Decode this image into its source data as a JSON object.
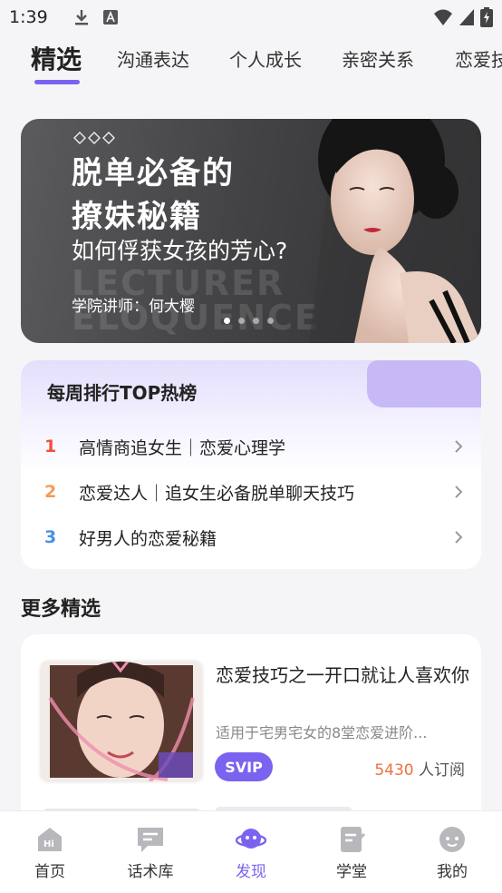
{
  "status_bar": {
    "time": "1:39"
  },
  "tabs": [
    {
      "label": "精选",
      "active": true
    },
    {
      "label": "沟通表达",
      "active": false
    },
    {
      "label": "个人成长",
      "active": false
    },
    {
      "label": "亲密关系",
      "active": false
    },
    {
      "label": "恋爱技",
      "active": false
    }
  ],
  "banner": {
    "title_line1": "脱单必备的",
    "title_line2": "撩妹秘籍",
    "subtitle": "如何俘获女孩的芳心?",
    "watermark_line1": "LECTURER",
    "watermark_line2": "ELOQUENCE",
    "lecturer": "学院讲师：何大樱",
    "slide_count": 4,
    "active_slide": 1
  },
  "ranking": {
    "title": "每周排行TOP热榜",
    "items": [
      {
        "rank": "1",
        "text": "高情商追女生｜恋爱心理学",
        "color": "#f0503c"
      },
      {
        "rank": "2",
        "text": "恋爱达人｜追女生必备脱单聊天技巧",
        "color": "#f59a5a"
      },
      {
        "rank": "3",
        "text": "好男人的恋爱秘籍",
        "color": "#4a90e2"
      }
    ]
  },
  "more_section": {
    "title": "更多精选"
  },
  "card": {
    "title": "恋爱技巧之一开口就让人喜欢你",
    "description": "适用于宅男宅女的8堂恋爱进阶...",
    "badge": "SVIP",
    "subscriber_count": "5430",
    "subscriber_suffix": " 人订阅"
  },
  "bottom_nav": [
    {
      "label": "首页",
      "icon": "home-hi-icon",
      "active": false
    },
    {
      "label": "话术库",
      "icon": "chat-bubble-icon",
      "active": false
    },
    {
      "label": "发现",
      "icon": "planet-icon",
      "active": true
    },
    {
      "label": "学堂",
      "icon": "notebook-icon",
      "active": false
    },
    {
      "label": "我的",
      "icon": "user-face-icon",
      "active": false
    }
  ],
  "colors": {
    "accent": "#7b63f0",
    "rank1": "#f0503c",
    "rank2": "#f59a5a",
    "rank3": "#4a90e2",
    "count": "#f07040"
  }
}
